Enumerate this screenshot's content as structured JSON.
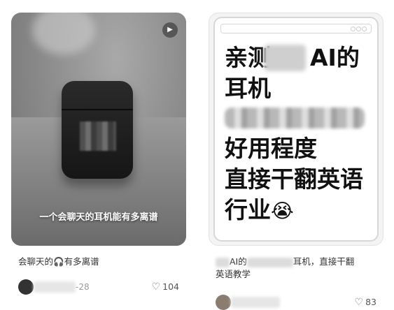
{
  "feed": {
    "cards": [
      {
        "caption": "一个会聊天的耳机能有多离谱",
        "title_before": "会聊天的",
        "title_icon": "headphone-icon",
        "title_after": "有多离谱",
        "date": "-28",
        "likes": "104",
        "play_icon": "play-icon"
      },
      {
        "overlay_line1": "亲测",
        "overlay_line1b": "AI的",
        "overlay_line2": "耳机",
        "overlay_line4": "好用程度",
        "overlay_line5": "直接干翻英语",
        "overlay_line6": "行业",
        "overlay_emoji": "😭",
        "title_part1": "AI的",
        "title_part2": "耳机，直接干翻",
        "title_line2": "英语教学",
        "likes": "83"
      }
    ],
    "like_icon": "heart-outline-icon"
  }
}
